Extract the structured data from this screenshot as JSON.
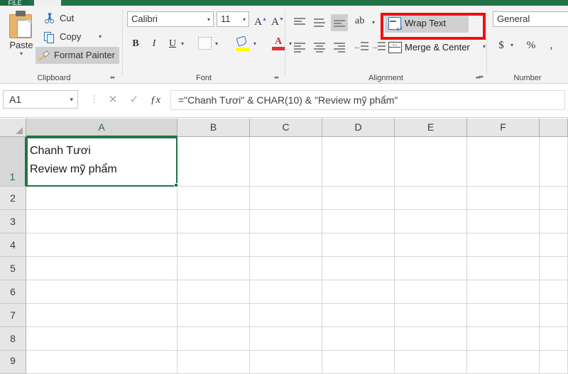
{
  "app": {
    "tabs": {
      "file": "FILE",
      "ghost_left": "",
      "ghost_right": ""
    }
  },
  "ribbon": {
    "groups": {
      "clipboard": {
        "label": "Clipboard",
        "paste": {
          "label": "Paste",
          "caret": "▾"
        },
        "cut": "Cut",
        "copy": "Copy",
        "copy_caret": "▾",
        "format_painter": "Format Painter",
        "launcher": "⬌"
      },
      "font": {
        "label": "Font",
        "font_name": "Calibri",
        "font_size": "11",
        "grow_font": "A",
        "shrink_font": "A",
        "bold": "B",
        "italic": "I",
        "underline": "U",
        "underline_caret": "▾",
        "border_caret": "▾",
        "fill_caret": "▾",
        "fontcolor_letter": "A",
        "fontcolor_caret": "▾",
        "launcher": "⬌"
      },
      "alignment": {
        "label": "Alignment",
        "wrap_text": "Wrap Text",
        "merge_center": "Merge & Center",
        "merge_caret": "▾",
        "orientation": "ab",
        "orientation_caret": "▾",
        "launcher": "⬌",
        "highlight_color": "#ee1111"
      },
      "number": {
        "label": "Number",
        "format": "General",
        "currency": "$",
        "currency_caret": "▾",
        "percent": "%",
        "comma": " ,",
        "launcher": "⬌"
      }
    }
  },
  "formula_bar": {
    "name_box": "A1",
    "name_box_caret": "▾",
    "cancel": "✕",
    "enter": "✓",
    "insert_function": "ƒx",
    "formula": "=\"Chanh Tươi\" & CHAR(10) & \"Review mỹ phẩm\""
  },
  "sheet": {
    "columns": [
      "A",
      "B",
      "C",
      "D",
      "E",
      "F"
    ],
    "rows": [
      "1",
      "2",
      "3",
      "4",
      "5",
      "6",
      "7",
      "8",
      "9"
    ],
    "selected_cell": "A1",
    "cell_a1_text": "Chanh Tươi\nReview mỹ phẩm",
    "selection_color": "#217346"
  }
}
